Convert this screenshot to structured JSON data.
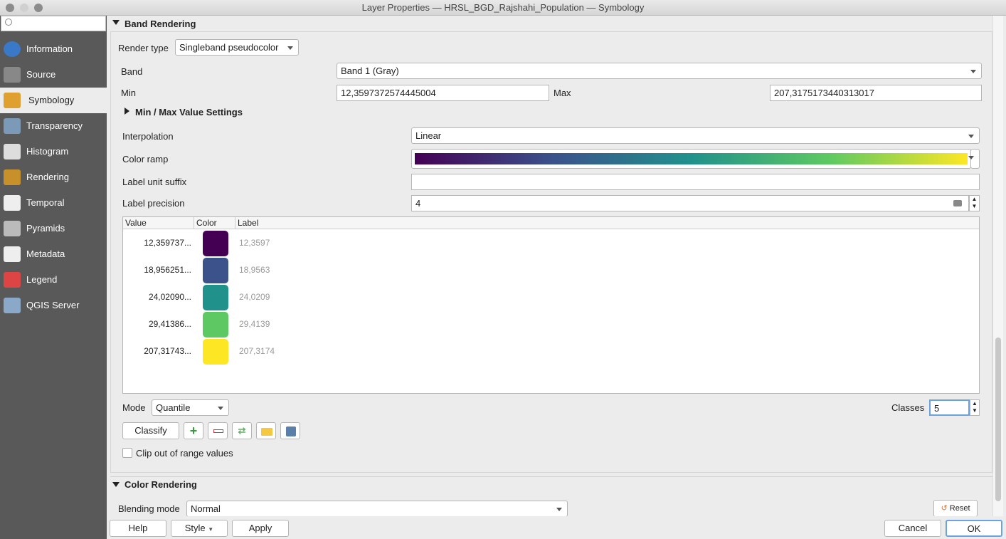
{
  "window": {
    "title": "Layer Properties — HRSL_BGD_Rajshahi_Population — Symbology"
  },
  "sidebar": {
    "search_placeholder": "",
    "items": [
      {
        "label": "Information",
        "icon": "info-icon"
      },
      {
        "label": "Source",
        "icon": "source-icon"
      },
      {
        "label": "Symbology",
        "icon": "paintbrush-icon",
        "selected": true
      },
      {
        "label": "Transparency",
        "icon": "transparency-icon"
      },
      {
        "label": "Histogram",
        "icon": "histogram-icon"
      },
      {
        "label": "Rendering",
        "icon": "rendering-icon"
      },
      {
        "label": "Temporal",
        "icon": "clock-icon"
      },
      {
        "label": "Pyramids",
        "icon": "pyramids-icon"
      },
      {
        "label": "Metadata",
        "icon": "metadata-icon"
      },
      {
        "label": "Legend",
        "icon": "legend-icon"
      },
      {
        "label": "QGIS Server",
        "icon": "server-icon"
      }
    ]
  },
  "band_rendering": {
    "title": "Band Rendering",
    "render_type_label": "Render type",
    "render_type": "Singleband pseudocolor",
    "band_label": "Band",
    "band": "Band 1 (Gray)",
    "min_label": "Min",
    "min": "12,3597372574445004",
    "max_label": "Max",
    "max": "207,3175173440313017",
    "minmax_settings": "Min / Max Value Settings",
    "interpolation_label": "Interpolation",
    "interpolation": "Linear",
    "color_ramp_label": "Color ramp",
    "color_ramp": [
      "#440154",
      "#3b528b",
      "#21918c",
      "#5ec962",
      "#fde725"
    ],
    "label_suffix_label": "Label unit suffix",
    "label_suffix": "",
    "label_precision_label": "Label precision",
    "label_precision": "4",
    "table": {
      "headers": [
        "Value",
        "Color",
        "Label"
      ],
      "rows": [
        {
          "value": "12,359737...",
          "color": "#440154",
          "label": "12,3597"
        },
        {
          "value": "18,956251...",
          "color": "#3b528b",
          "label": "18,9563"
        },
        {
          "value": "24,02090...",
          "color": "#21918c",
          "label": "24,0209"
        },
        {
          "value": "29,41386...",
          "color": "#5ec962",
          "label": "29,4139"
        },
        {
          "value": "207,31743...",
          "color": "#fde725",
          "label": "207,3174"
        }
      ]
    },
    "mode_label": "Mode",
    "mode": "Quantile",
    "classes_label": "Classes",
    "classes": "5",
    "classify": "Classify",
    "clip_label": "Clip out of range values"
  },
  "color_rendering": {
    "title": "Color Rendering",
    "blending_label": "Blending mode",
    "blending": "Normal",
    "reset": "Reset"
  },
  "footer": {
    "help": "Help",
    "style": "Style",
    "apply": "Apply",
    "cancel": "Cancel",
    "ok": "OK"
  }
}
